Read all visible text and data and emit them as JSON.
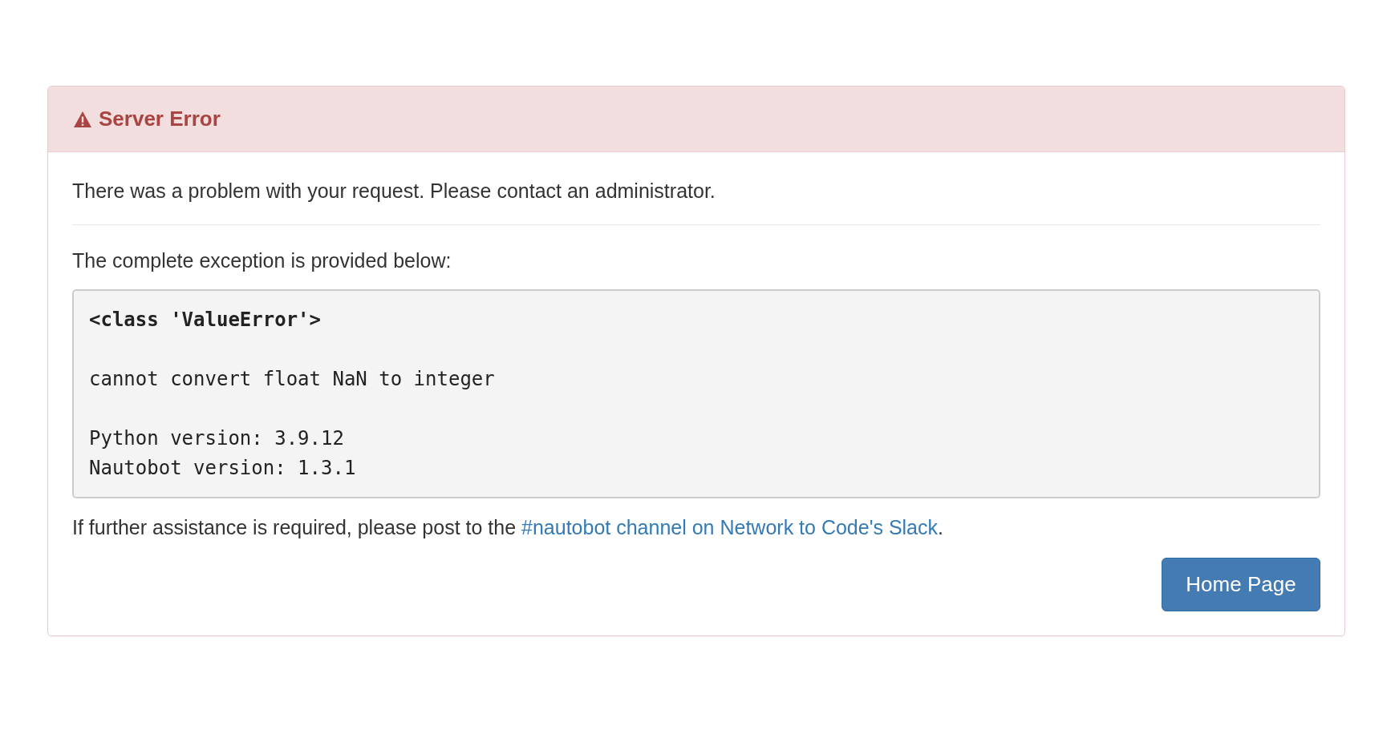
{
  "panel": {
    "title": "Server Error",
    "message": "There was a problem with your request. Please contact an administrator.",
    "exception_intro": "The complete exception is provided below:",
    "exception": {
      "type": "<class 'ValueError'>",
      "message": "cannot convert float NaN to integer",
      "versions": [
        "Python version: 3.9.12",
        "Nautobot version: 1.3.1"
      ]
    },
    "help": {
      "before": "If further assistance is required, please post to the ",
      "link": "#nautobot channel on Network to Code's Slack",
      "after": "."
    },
    "buttons": [
      "Home Page"
    ]
  }
}
